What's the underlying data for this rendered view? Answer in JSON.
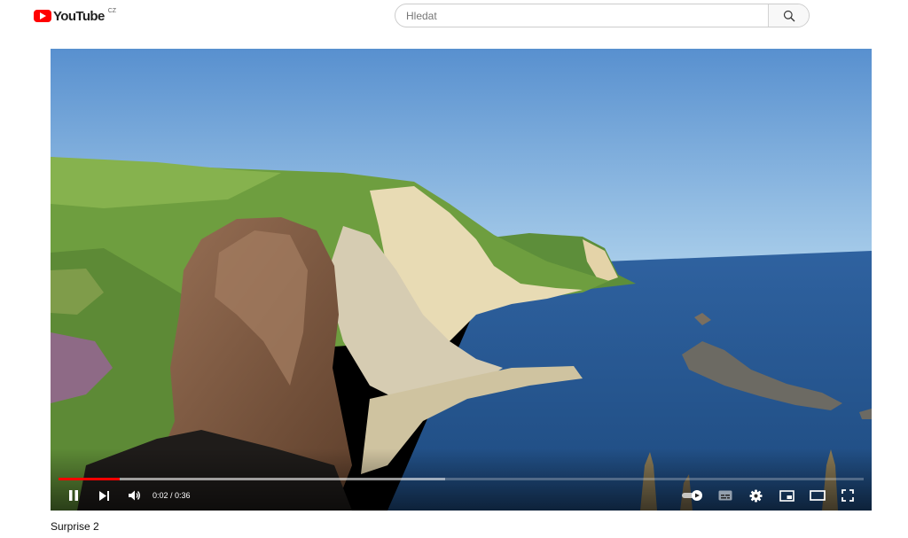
{
  "header": {
    "logo_text": "YouTube",
    "country_code": "CZ",
    "search_placeholder": "Hledat"
  },
  "player": {
    "current_time": "0:02",
    "duration": "0:36",
    "time_separator": " / ",
    "progress_played": 0.076,
    "progress_buffered": 0.48,
    "autoplay_on": true,
    "icons": [
      "pause-icon",
      "next-icon",
      "volume-icon",
      "autoplay-toggle-icon",
      "subtitles-icon",
      "settings-icon",
      "miniplayer-icon",
      "theater-icon",
      "fullscreen-icon"
    ]
  },
  "video": {
    "title": "Surprise 2"
  },
  "colors": {
    "brand_red": "#ff0000",
    "sky": "#5e94cf",
    "sea": "#2d5f97"
  }
}
